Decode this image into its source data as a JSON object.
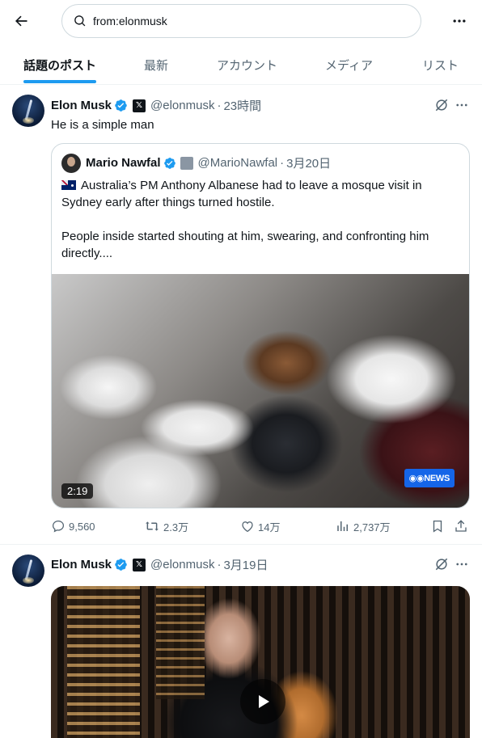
{
  "search": {
    "value": "from:elonmusk"
  },
  "tabs": [
    {
      "label": "話題のポスト"
    },
    {
      "label": "最新"
    },
    {
      "label": "アカウント"
    },
    {
      "label": "メディア"
    },
    {
      "label": "リスト"
    }
  ],
  "tweets": [
    {
      "name": "Elon Musk",
      "handle": "@elonmusk",
      "time": "23時間",
      "text": "He is a simple man",
      "quote": {
        "name": "Mario Nawfal",
        "handle": "@MarioNawfal",
        "time": "3月20日",
        "text_1": "Australia’s PM Anthony Albanese had to leave a mosque visit in Sydney early after things turned hostile.",
        "text_2": "People inside started shouting at him, swearing, and confronting him directly....",
        "video_duration": "2:19",
        "video_badge": "NEWS"
      },
      "stats": {
        "replies": "9,560",
        "reposts": "2.3万",
        "likes": "14万",
        "views": "2,737万"
      }
    },
    {
      "name": "Elon Musk",
      "handle": "@elonmusk",
      "time": "3月19日"
    }
  ],
  "colors": {
    "accent": "#1d9bf0",
    "text": "#0f1419",
    "secondary": "#536471",
    "border": "#cfd9de"
  }
}
